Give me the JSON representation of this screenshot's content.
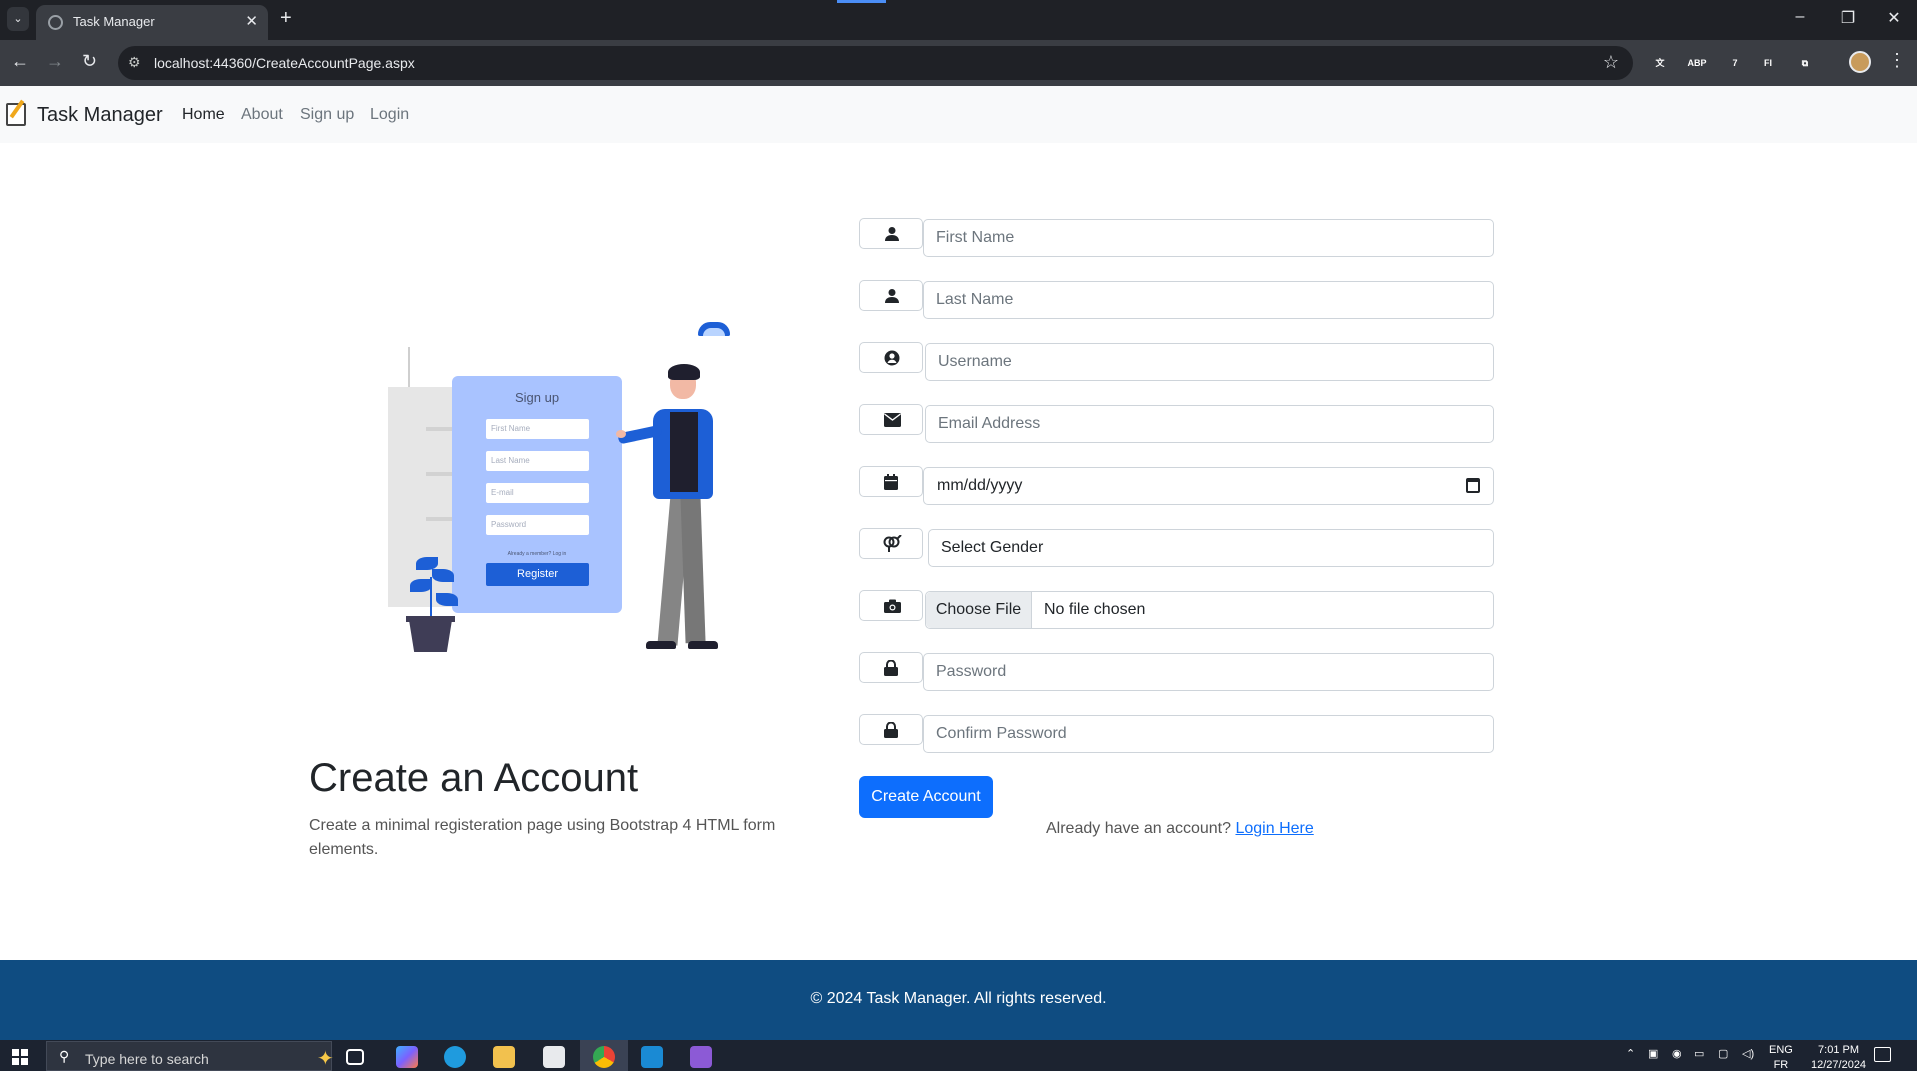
{
  "browser": {
    "tab_title": "Task Manager",
    "tab_close": "✕",
    "new_tab": "+",
    "tab_dropdown": "⌄",
    "url": "localhost:44360/CreateAccountPage.aspx",
    "window_minimize": "–",
    "window_restore": "❐",
    "window_close": "✕",
    "back": "←",
    "forward": "→",
    "reload": "↻",
    "bookmark": "☆",
    "menu": "⋮",
    "extensions": [
      {
        "name": "translate-icon",
        "label": "文",
        "color": "#3a3d43"
      },
      {
        "name": "adblock-icon",
        "label": "ABP",
        "color": "#e8344c"
      },
      {
        "name": "extension-badge-icon",
        "label": "7",
        "color": "#6f3ad1"
      },
      {
        "name": "fi-extension-icon",
        "label": "FI",
        "color": "#1a73e8"
      },
      {
        "name": "puzzle-icon",
        "label": "⧉",
        "color": "#3a3d43"
      }
    ]
  },
  "navbar": {
    "brand": "Task Manager",
    "links": [
      {
        "label": "Home",
        "active": true
      },
      {
        "label": "About",
        "active": false
      },
      {
        "label": "Sign up",
        "active": false
      },
      {
        "label": "Login",
        "active": false
      }
    ]
  },
  "illustration": {
    "title": "Sign up",
    "fields": [
      "First Name",
      "Last Name",
      "E-mail",
      "Password"
    ],
    "member_text": "Already a member? Log in",
    "button": "Register"
  },
  "intro": {
    "heading": "Create an Account",
    "lead": "Create a minimal registeration page using Bootstrap 4 HTML form elements."
  },
  "form": {
    "first_name_placeholder": "First Name",
    "last_name_placeholder": "Last Name",
    "username_placeholder": "Username",
    "email_placeholder": "Email Address",
    "date_value": "mm/dd/yyyy",
    "gender_value": "Select Gender",
    "file_button": "Choose File",
    "file_status": "No file chosen",
    "password_placeholder": "Password",
    "confirm_password_placeholder": "Confirm Password",
    "submit": "Create Account",
    "already_text": "Already have an account?",
    "login_link": "Login Here"
  },
  "footer": {
    "text": "© 2024 Task Manager. All rights reserved."
  },
  "taskbar": {
    "search_placeholder": "Type here to search",
    "language": "ENG",
    "language_sub": "FR",
    "time": "7:01 PM",
    "date": "12/27/2024",
    "apps": [
      {
        "name": "task-view-icon",
        "color": "#1c2330"
      },
      {
        "name": "copilot-icon",
        "color": "#7b61ff"
      },
      {
        "name": "edge-icon",
        "color": "#1f9bde"
      },
      {
        "name": "file-explorer-icon",
        "color": "#f2c14e"
      },
      {
        "name": "store-icon",
        "color": "#e8eaed"
      },
      {
        "name": "chrome-icon",
        "color": "#ea4335"
      },
      {
        "name": "vscode-icon",
        "color": "#1a8ad4"
      },
      {
        "name": "visual-studio-icon",
        "color": "#8c5ad6"
      }
    ]
  },
  "colors": {
    "primary": "#0d6efd",
    "footer": "#0f4c81",
    "navbar": "#f8f9fa"
  }
}
